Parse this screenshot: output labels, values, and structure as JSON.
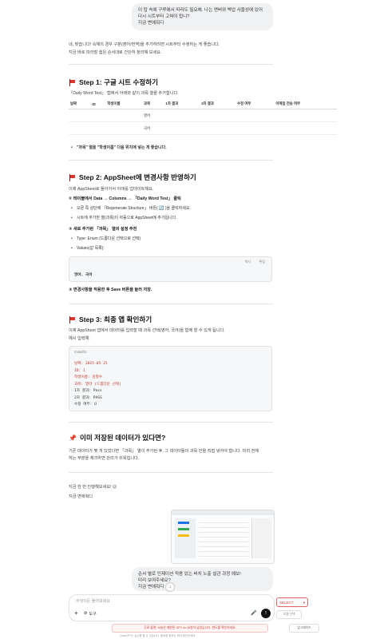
{
  "user_msg1": {
    "line1": "이 탑 속에 구루에서 따라도 필요해. 나는 앤버와 백업 사을성에 있어",
    "line2": "다시 시트부터 고쳐야 됩니?",
    "line3": "지금 변에줘디"
  },
  "reply_intro": {
    "line1": "네, 맞습니다! 속해의 경우 구분(영어/번역)을 추가하려면 시트부터 수정하는 게 좋습니다.",
    "line2": "지금 바로 따라할 쉽은 순서대로 간단히 정리해 보세요."
  },
  "step1": {
    "title": "Step 1: 구글 시트 수정하기",
    "desc": "「Daily Word Test」 탭에서 아래와 같이 과목 열을 추가합니다.",
    "columns": [
      "날짜",
      "ID",
      "학생이름",
      "과목",
      "1차 결과",
      "2차 결과",
      "수정 여부",
      "이메일 전송 여부"
    ],
    "rows": [
      [
        "",
        "",
        "",
        "영어",
        "",
        "",
        "",
        ""
      ],
      [
        "",
        "",
        "",
        "국어",
        "",
        "",
        "",
        ""
      ]
    ],
    "note": "\"과목\" 열을 \"학생이름\" 다음 위치에 넣는 게 좋습니다."
  },
  "step2": {
    "title": "Step 2: AppSheet에 변경사항 반영하기",
    "desc": "이제 AppSheet로 돌아가서 아래를 업데이트해요.",
    "sub1": "① 테이블에서 Data → Columns → 「Daily Word Test」 클릭",
    "bullet1": "오른 쪽 상단에 「Regenerate Structure」 버튼( 🔄 )을 클릭하세요.",
    "bullet2": "시트에 추가한 열(과목)이 자동으로 AppSheet에 추가됩니다.",
    "sub2": "② 새로 추가된 「과목」 열의 설정 추천",
    "bullet3": "Type: Enum (드롭다운 선택으로 선택)",
    "bullet4": "Values(값 목록):",
    "code_label1": "복사",
    "code_label2": "편집",
    "code": "영어, 국어",
    "sub3": "③ 변경사항을 적용한 후 Save 버튼을 눌러 저장."
  },
  "step3": {
    "title": "Step 3: 최종 앱 확인하기",
    "desc": "이제 AppSheet 앱에서 데이터를 입력할 때 과목 선택(영어, 국어)을 함께 할 수 있게 됩니다.",
    "desc2": "예시 입력예:",
    "code_lang": "makefile",
    "code_lines": [
      "날짜: 2025-05-25",
      "ID: 1",
      "학생이름: 김철수",
      "과목: 영어 (드롭다운 선택)",
      "1차 결과: Pass",
      "2차 결과: PASS",
      "수정 여부: O"
    ]
  },
  "section4": {
    "title": "이미 저장된 데이터가 있다면?",
    "line1": "기존 데이터가 몇 개 있었다면 「과목」 열이 추가된 후, 그 데이터들의 과목 칸을 직접 넣어야 합니다. 미리 전체",
    "line2": "하는 부분을 체크하면 관리가 쉬워집니다."
  },
  "closing": {
    "line1": "지금 한 번 진행해보세요! 😊",
    "line2": "지금 변에줘디"
  },
  "user_msg2": {
    "line1": "순서 별로 인제이션 적용 있는 버치 노출 설관 과정 예보!",
    "line2": "미리 보여주세요?",
    "line3": "지금 변에줘디"
  },
  "input": {
    "placeholder": "무엇이든 물어보세요",
    "plus": "+",
    "tools": "도구",
    "select_label": "SELECT",
    "select_chevron": "▾",
    "right_small": "모델 선택"
  },
  "footer": {
    "warn": "무료 플랜: 오늘은 제한된 GPT-4o 요청이 남았습니다. 한도를 확인하세요.",
    "right": "업그레이드",
    "fine": "ChatGPT는 실수를 할 수 있습니다. 중요한 정보는 재차 확인하세요."
  }
}
